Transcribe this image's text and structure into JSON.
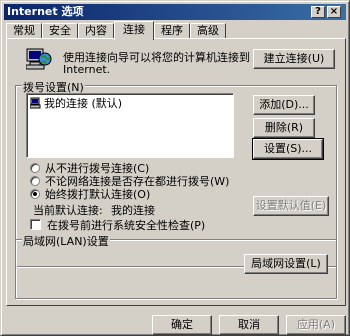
{
  "window": {
    "title": "Internet 选项",
    "help_glyph": "?",
    "close_glyph": "×"
  },
  "tabs": [
    {
      "label": "常规"
    },
    {
      "label": "安全"
    },
    {
      "label": "内容"
    },
    {
      "label": "连接"
    },
    {
      "label": "程序"
    },
    {
      "label": "高级"
    }
  ],
  "active_tab": "连接",
  "setup": {
    "description_line1": "使用连接向导可以将您的计算机连接到",
    "description_line2": "Internet.",
    "button": "建立连接(U)"
  },
  "dialup": {
    "group_label": "拨号设置(N)",
    "list_items": [
      {
        "label": "我的连接 (默认)"
      }
    ],
    "add_button": "添加(D)...",
    "delete_button": "删除(R)",
    "settings_button": "设置(S)...",
    "radios": [
      {
        "label": "从不进行拨号连接(C)",
        "checked": false
      },
      {
        "label": "不论网络连接是否存在都进行拨号(W)",
        "checked": false
      },
      {
        "label": "始终拨打默认连接(O)",
        "checked": true
      }
    ],
    "current_default_label": "当前默认连接:",
    "current_default_value": "我的连接",
    "set_default_button": "设置默认值(E)",
    "security_check_label": "在拨号前进行系统安全性检查(P)",
    "security_check_checked": false
  },
  "lan": {
    "group_label": "局域网(LAN)设置",
    "button": "局域网设置(L)"
  },
  "footer": {
    "ok": "确定",
    "cancel": "取消",
    "apply": "应用(A)"
  }
}
